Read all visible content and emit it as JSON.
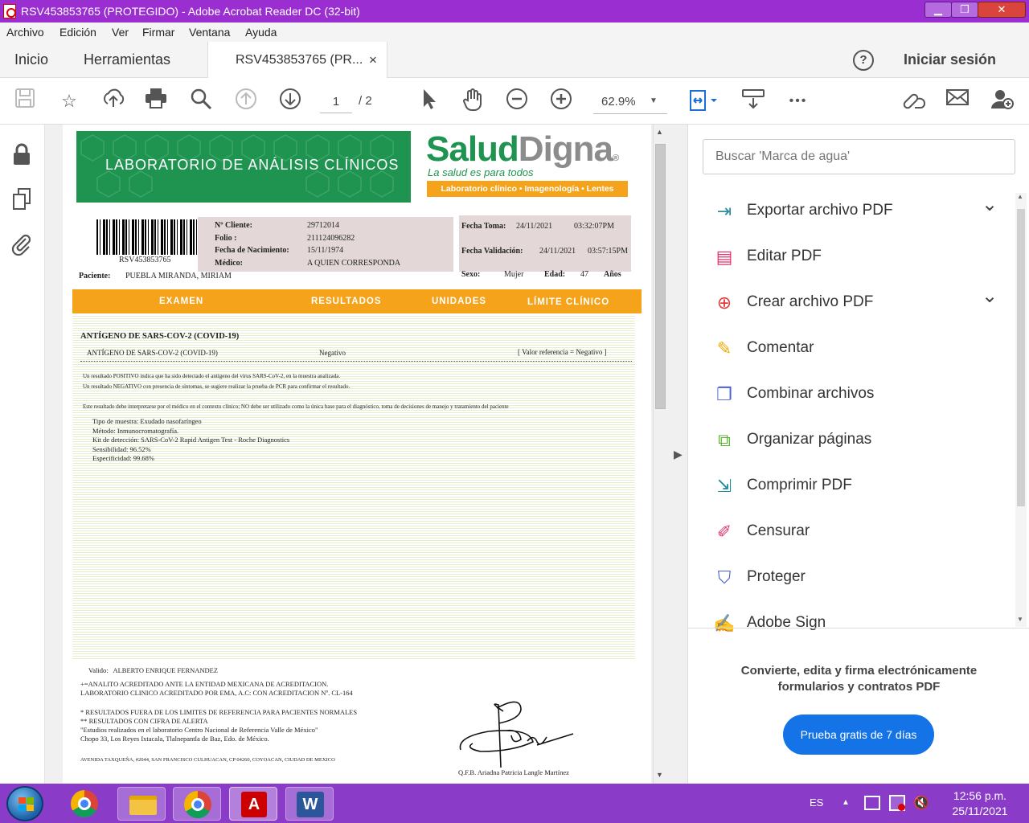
{
  "window": {
    "title": "RSV453853765 (PROTEGIDO) - Adobe Acrobat Reader DC (32-bit)",
    "minimize": "▁",
    "restore": "❐",
    "close": "✕"
  },
  "menu": [
    "Archivo",
    "Edición",
    "Ver",
    "Firmar",
    "Ventana",
    "Ayuda"
  ],
  "tabs": {
    "home": "Inicio",
    "tools": "Herramientas",
    "doc": "RSV453853765 (PR...",
    "doc_close": "×",
    "help": "?",
    "signin": "Iniciar sesión"
  },
  "toolbar": {
    "page_current": "1",
    "page_total": "/ 2",
    "zoom": "62.9%",
    "zoom_arrow": "▼",
    "more": "•••"
  },
  "document": {
    "banner_left": "LABORATORIO DE ANÁLISIS CLÍNICOS",
    "brand_salud": "Salud",
    "brand_digna": "Digna",
    "brand_reg": "®",
    "brand_slogan": "La salud es para todos",
    "brand_services": "Laboratorio clínico • Imagenología • Lentes",
    "barcode_number": "RSV453853765",
    "labels": {
      "cliente": "Nº Cliente:",
      "folio": "Folio :",
      "nacimiento": "Fecha de Nacimiento:",
      "medico": "Médico:",
      "paciente": "Paciente:",
      "toma": "Fecha Toma:",
      "validacion": "Fecha Validación:",
      "sexo": "Sexo:",
      "edad": "Edad:",
      "anios": "Años"
    },
    "values": {
      "cliente": "29712014",
      "folio": "211124096282",
      "nacimiento": "15/11/1974",
      "medico": "A QUIEN CORRESPONDA",
      "paciente": "PUEBLA MIRANDA, MIRIAM",
      "toma_fecha": "24/11/2021",
      "toma_hora": "03:32:07PM",
      "val_fecha": "24/11/2021",
      "val_hora": "03:57:15PM",
      "sexo": "Mujer",
      "edad": "47"
    },
    "columns": [
      "EXAMEN",
      "RESULTADOS",
      "UNIDADES",
      "LÍMITE CLÍNICO"
    ],
    "section_title": "ANTÍGENO DE SARS-COV-2 (COVID-19)",
    "row": {
      "exam": "ANTÍGENO DE SARS-COV-2 (COVID-19)",
      "result": "Negativo",
      "ref": "[ Valor referencia = Negativo ]"
    },
    "notes": [
      "Un resultado POSITIVO indica que ha sido detectado el antígeno del virus SARS-CoV-2, en la muestra analizada.",
      "Un resultado NEGATIVO con presencia de síntomas, se sugiere realizar la prueba de PCR para confirmar el resultado."
    ],
    "disclaimer": "Este resultado debe interpretarse por el médico en el contexto clínico; NO debe ser utilizado como la única base para el diagnóstico, toma de decisiones de manejo y tratamiento del paciente",
    "method": [
      "Tipo de muestra: Exudado nasofaríngeo",
      "Método: Inmunocromatografía.",
      "Kit de detección: SARS-CoV-2 Rapid Antigen Test - Roche Diagnostics",
      "Sensibilidad: 96.52%",
      "Especificidad: 99.68%"
    ],
    "valido": "Valido:   ALBERTO ENRIQUE FERNANDEZ",
    "accred": [
      "+=ANALITO ACREDITADO ANTE LA ENTIDAD MEXICANA DE ACREDITACION.",
      "LABORATORIO CLINICO ACREDITADO POR EMA, A.C: CON ACREDITACION Nº. CL-164"
    ],
    "footnotes": [
      "* RESULTADOS FUERA DE LOS LIMITES DE REFERENCIA PARA PACIENTES NORMALES",
      "** RESULTADOS CON CIFRA DE ALERTA",
      "\"Estudios realizados en el laboratorio Centro Nacional de Referencia Valle de México\"",
      "Chopo 33, Los Reyes Ixtacala, Tlalnepantla de Baz, Edo. de México."
    ],
    "address": "AVENIDA TAXQUEÑA, #2044, SAN FRANCISCO CULHUACAN, CP 04260, COYOACAN, CIUDAD DE MEXICO",
    "signer": "Q.F.B. Ariadna Patricia Langle Martínez"
  },
  "right_pane": {
    "search_placeholder": "Buscar 'Marca de agua'",
    "tools": [
      {
        "label": "Exportar archivo PDF",
        "icon": "export-pdf-icon",
        "color": "#2d8c9e",
        "glyph": "⇥"
      },
      {
        "label": "Editar PDF",
        "icon": "edit-pdf-icon",
        "color": "#e0336c",
        "glyph": "▤"
      },
      {
        "label": "Crear archivo PDF",
        "icon": "create-pdf-icon",
        "color": "#e03a3a",
        "glyph": "⊕"
      },
      {
        "label": "Comentar",
        "icon": "comment-icon",
        "color": "#f0a800",
        "glyph": "✎"
      },
      {
        "label": "Combinar archivos",
        "icon": "combine-icon",
        "color": "#4a5fd8",
        "glyph": "❐"
      },
      {
        "label": "Organizar páginas",
        "icon": "organize-icon",
        "color": "#5db32f",
        "glyph": "⧉"
      },
      {
        "label": "Comprimir PDF",
        "icon": "compress-icon",
        "color": "#1d8c9e",
        "glyph": "⇲"
      },
      {
        "label": "Censurar",
        "icon": "redact-icon",
        "color": "#e0336c",
        "glyph": "✐"
      },
      {
        "label": "Proteger",
        "icon": "protect-icon",
        "color": "#4a5fd8",
        "glyph": "⛉"
      },
      {
        "label": "Adobe Sign",
        "icon": "adobe-sign-icon",
        "color": "#8a3fc9",
        "glyph": "✍"
      }
    ],
    "promo": "Convierte, edita y firma electrónicamente formularios y contratos PDF",
    "trial": "Prueba gratis de 7 días"
  },
  "taskbar": {
    "lang": "ES",
    "time": "12:56 p.m.",
    "date": "25/11/2021"
  }
}
